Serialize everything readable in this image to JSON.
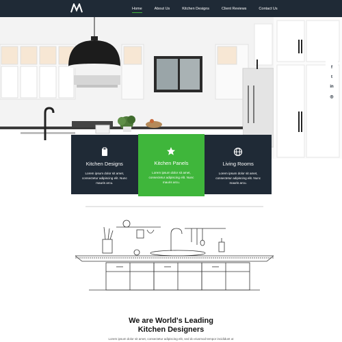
{
  "nav": {
    "links": [
      {
        "label": "Home",
        "active": true
      },
      {
        "label": "About Us",
        "active": false
      },
      {
        "label": "Kitchen Designs",
        "active": false
      },
      {
        "label": "Client Reviews",
        "active": false
      },
      {
        "label": "Contact Us",
        "active": false
      }
    ]
  },
  "social": {
    "icons": [
      {
        "name": "facebook-icon",
        "glyph": "f"
      },
      {
        "name": "twitter-icon",
        "glyph": "t"
      },
      {
        "name": "linkedin-icon",
        "glyph": "in"
      },
      {
        "name": "instagram-icon",
        "glyph": "◎"
      }
    ]
  },
  "cards": [
    {
      "title": "Kitchen Designs",
      "text": "Lorem ipsum dolor sit amet, consectetur adipiscing elit. Nunc mauris arcu.",
      "icon": "clipboard-icon"
    },
    {
      "title": "Kitchen Panels",
      "text": "Lorem ipsum dolor sit amet, consectetur adipiscing elit. Nunc mauris arcu.",
      "icon": "star-icon"
    },
    {
      "title": "Living Rooms",
      "text": "Lorem ipsum dolor sit amet, consectetur adipiscing elit. Nunc mauris arcu.",
      "icon": "globe-icon"
    }
  ],
  "headline": {
    "line1": "We are World's Leading",
    "line2": "Kitchen Designers"
  },
  "subtext": "Lorem ipsum dolor sit amet, consectetur adipiscing elit, sed do eiusmod tempor incididunt ut",
  "colors": {
    "nav_bg": "#1f2a36",
    "accent": "#3fb63b",
    "card_dark": "#1f2a36"
  }
}
